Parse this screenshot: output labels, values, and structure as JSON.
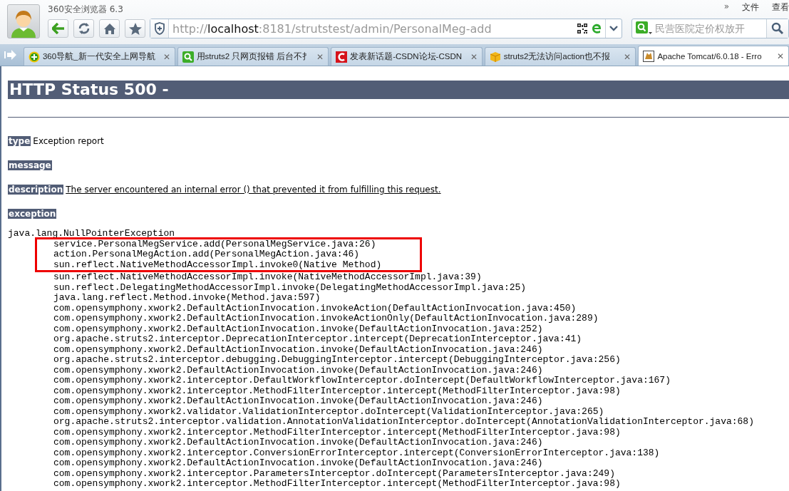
{
  "window": {
    "title": "360安全浏览器 6.3",
    "menu": [
      "»",
      "文件",
      "查看"
    ]
  },
  "address_bar": {
    "scheme": "http://",
    "host": "localhost",
    "path": ":8181/strutstest/admin/PersonalMeg-add"
  },
  "search": {
    "placeholder": "民营医院定价权放开"
  },
  "tabs": [
    {
      "label": "360导航_新一代安全上网导航",
      "close": "✕",
      "selected": false
    },
    {
      "label": "用struts2 只网页报错 后台不扌",
      "close": "✕",
      "selected": false
    },
    {
      "label": "发表新话题-CSDN论坛-CSDN",
      "close": "✕",
      "selected": false
    },
    {
      "label": "struts2无法访问action也不报",
      "close": "✕",
      "selected": false
    },
    {
      "label": "Apache Tomcat/6.0.18 - Erro",
      "close": "✕",
      "selected": true
    }
  ],
  "page": {
    "heading": "HTTP Status 500 -",
    "fields": [
      {
        "label": "type",
        "value": "Exception report"
      },
      {
        "label": "message"
      },
      {
        "label": "description",
        "value": "The server encountered an internal error () that prevented it from fulfilling this request."
      },
      {
        "label": "exception"
      }
    ],
    "exception": "java.lang.NullPointerException",
    "trace": [
      {
        "text": "service.PersonalMegService.add(PersonalMegService.java:26)",
        "highlighted": true
      },
      {
        "text": "action.PersonalMegAction.add(PersonalMegAction.java:46)",
        "highlighted": true
      },
      {
        "text": "sun.reflect.NativeMethodAccessorImpl.invoke0(Native Method)",
        "highlighted": true
      },
      {
        "text": "sun.reflect.NativeMethodAccessorImpl.invoke(NativeMethodAccessorImpl.java:39)",
        "highlighted": false
      },
      {
        "text": "sun.reflect.DelegatingMethodAccessorImpl.invoke(DelegatingMethodAccessorImpl.java:25)",
        "highlighted": false
      },
      {
        "text": "java.lang.reflect.Method.invoke(Method.java:597)",
        "highlighted": false
      },
      {
        "text": "com.opensymphony.xwork2.DefaultActionInvocation.invokeAction(DefaultActionInvocation.java:450)",
        "highlighted": false
      },
      {
        "text": "com.opensymphony.xwork2.DefaultActionInvocation.invokeActionOnly(DefaultActionInvocation.java:289)",
        "highlighted": false
      },
      {
        "text": "com.opensymphony.xwork2.DefaultActionInvocation.invoke(DefaultActionInvocation.java:252)",
        "highlighted": false
      },
      {
        "text": "org.apache.struts2.interceptor.DeprecationInterceptor.intercept(DeprecationInterceptor.java:41)",
        "highlighted": false
      },
      {
        "text": "com.opensymphony.xwork2.DefaultActionInvocation.invoke(DefaultActionInvocation.java:246)",
        "highlighted": false
      },
      {
        "text": "org.apache.struts2.interceptor.debugging.DebuggingInterceptor.intercept(DebuggingInterceptor.java:256)",
        "highlighted": false
      },
      {
        "text": "com.opensymphony.xwork2.DefaultActionInvocation.invoke(DefaultActionInvocation.java:246)",
        "highlighted": false
      },
      {
        "text": "com.opensymphony.xwork2.interceptor.DefaultWorkflowInterceptor.doIntercept(DefaultWorkflowInterceptor.java:167)",
        "highlighted": false
      },
      {
        "text": "com.opensymphony.xwork2.interceptor.MethodFilterInterceptor.intercept(MethodFilterInterceptor.java:98)",
        "highlighted": false
      },
      {
        "text": "com.opensymphony.xwork2.DefaultActionInvocation.invoke(DefaultActionInvocation.java:246)",
        "highlighted": false
      },
      {
        "text": "com.opensymphony.xwork2.validator.ValidationInterceptor.doIntercept(ValidationInterceptor.java:265)",
        "highlighted": false
      },
      {
        "text": "org.apache.struts2.interceptor.validation.AnnotationValidationInterceptor.doIntercept(AnnotationValidationInterceptor.java:68)",
        "highlighted": false
      },
      {
        "text": "com.opensymphony.xwork2.interceptor.MethodFilterInterceptor.intercept(MethodFilterInterceptor.java:98)",
        "highlighted": false
      },
      {
        "text": "com.opensymphony.xwork2.DefaultActionInvocation.invoke(DefaultActionInvocation.java:246)",
        "highlighted": false
      },
      {
        "text": "com.opensymphony.xwork2.interceptor.ConversionErrorInterceptor.intercept(ConversionErrorInterceptor.java:138)",
        "highlighted": false
      },
      {
        "text": "com.opensymphony.xwork2.DefaultActionInvocation.invoke(DefaultActionInvocation.java:246)",
        "highlighted": false
      },
      {
        "text": "com.opensymphony.xwork2.interceptor.ParametersInterceptor.doIntercept(ParametersInterceptor.java:249)",
        "highlighted": false
      },
      {
        "text": "com.opensymphony.xwork2.interceptor.MethodFilterInterceptor.intercept(MethodFilterInterceptor.java:98)",
        "highlighted": false
      }
    ]
  }
}
